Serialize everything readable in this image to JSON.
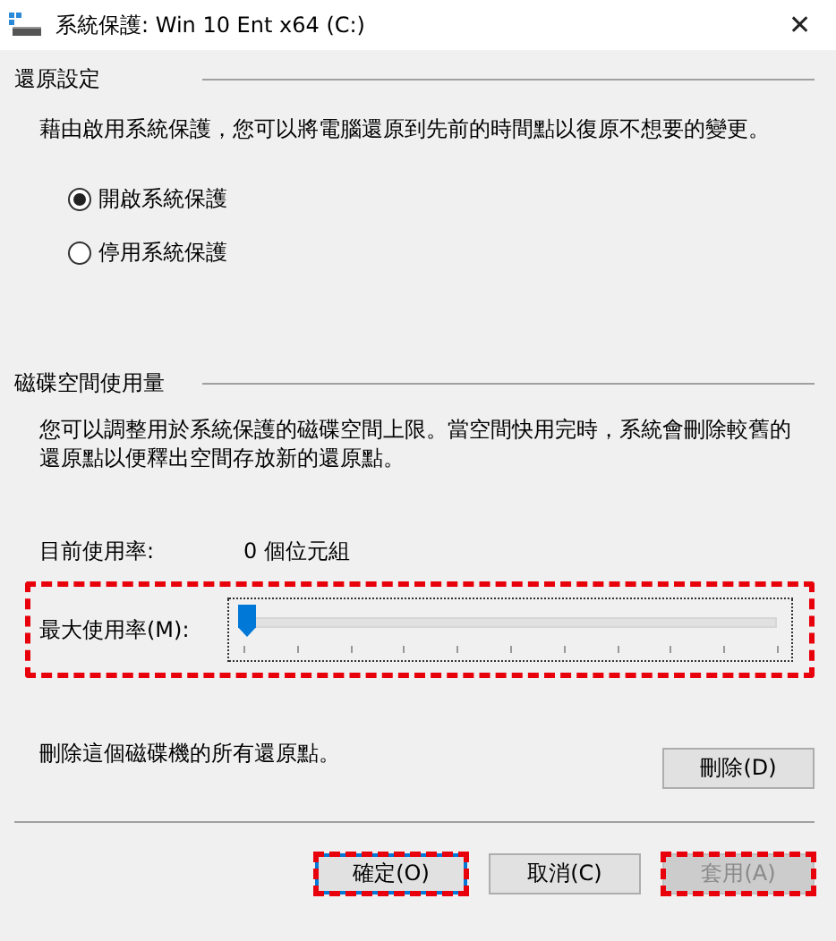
{
  "window": {
    "title": "系統保護: Win 10 Ent x64 (C:)",
    "close": "✕"
  },
  "restore_settings": {
    "heading": "還原設定",
    "description": "藉由啟用系統保護，您可以將電腦還原到先前的時間點以復原不想要的變更。",
    "options": [
      {
        "label": "開啟系統保護",
        "selected": true
      },
      {
        "label": "停用系統保護",
        "selected": false
      }
    ]
  },
  "disk_usage": {
    "heading": "磁碟空間使用量",
    "description": "您可以調整用於系統保護的磁碟空間上限。當空間快用完時，系統會刪除較舊的還原點以便釋出空間存放新的還原點。",
    "current_label": "目前使用率:",
    "current_value": "0 個位元組",
    "max_usage": {
      "label": "最大使用率(M):",
      "level": 0,
      "highlighted": true
    }
  },
  "delete": {
    "description": "刪除這個磁碟機的所有還原點。",
    "button": "刪除(D)"
  },
  "buttons": [
    {
      "label": "確定(O)",
      "default": true,
      "disabled": false,
      "highlighted": true
    },
    {
      "label": "取消(C)",
      "default": false,
      "disabled": false,
      "highlighted": false
    },
    {
      "label": "套用(A)",
      "default": false,
      "disabled": true,
      "highlighted": true
    }
  ]
}
